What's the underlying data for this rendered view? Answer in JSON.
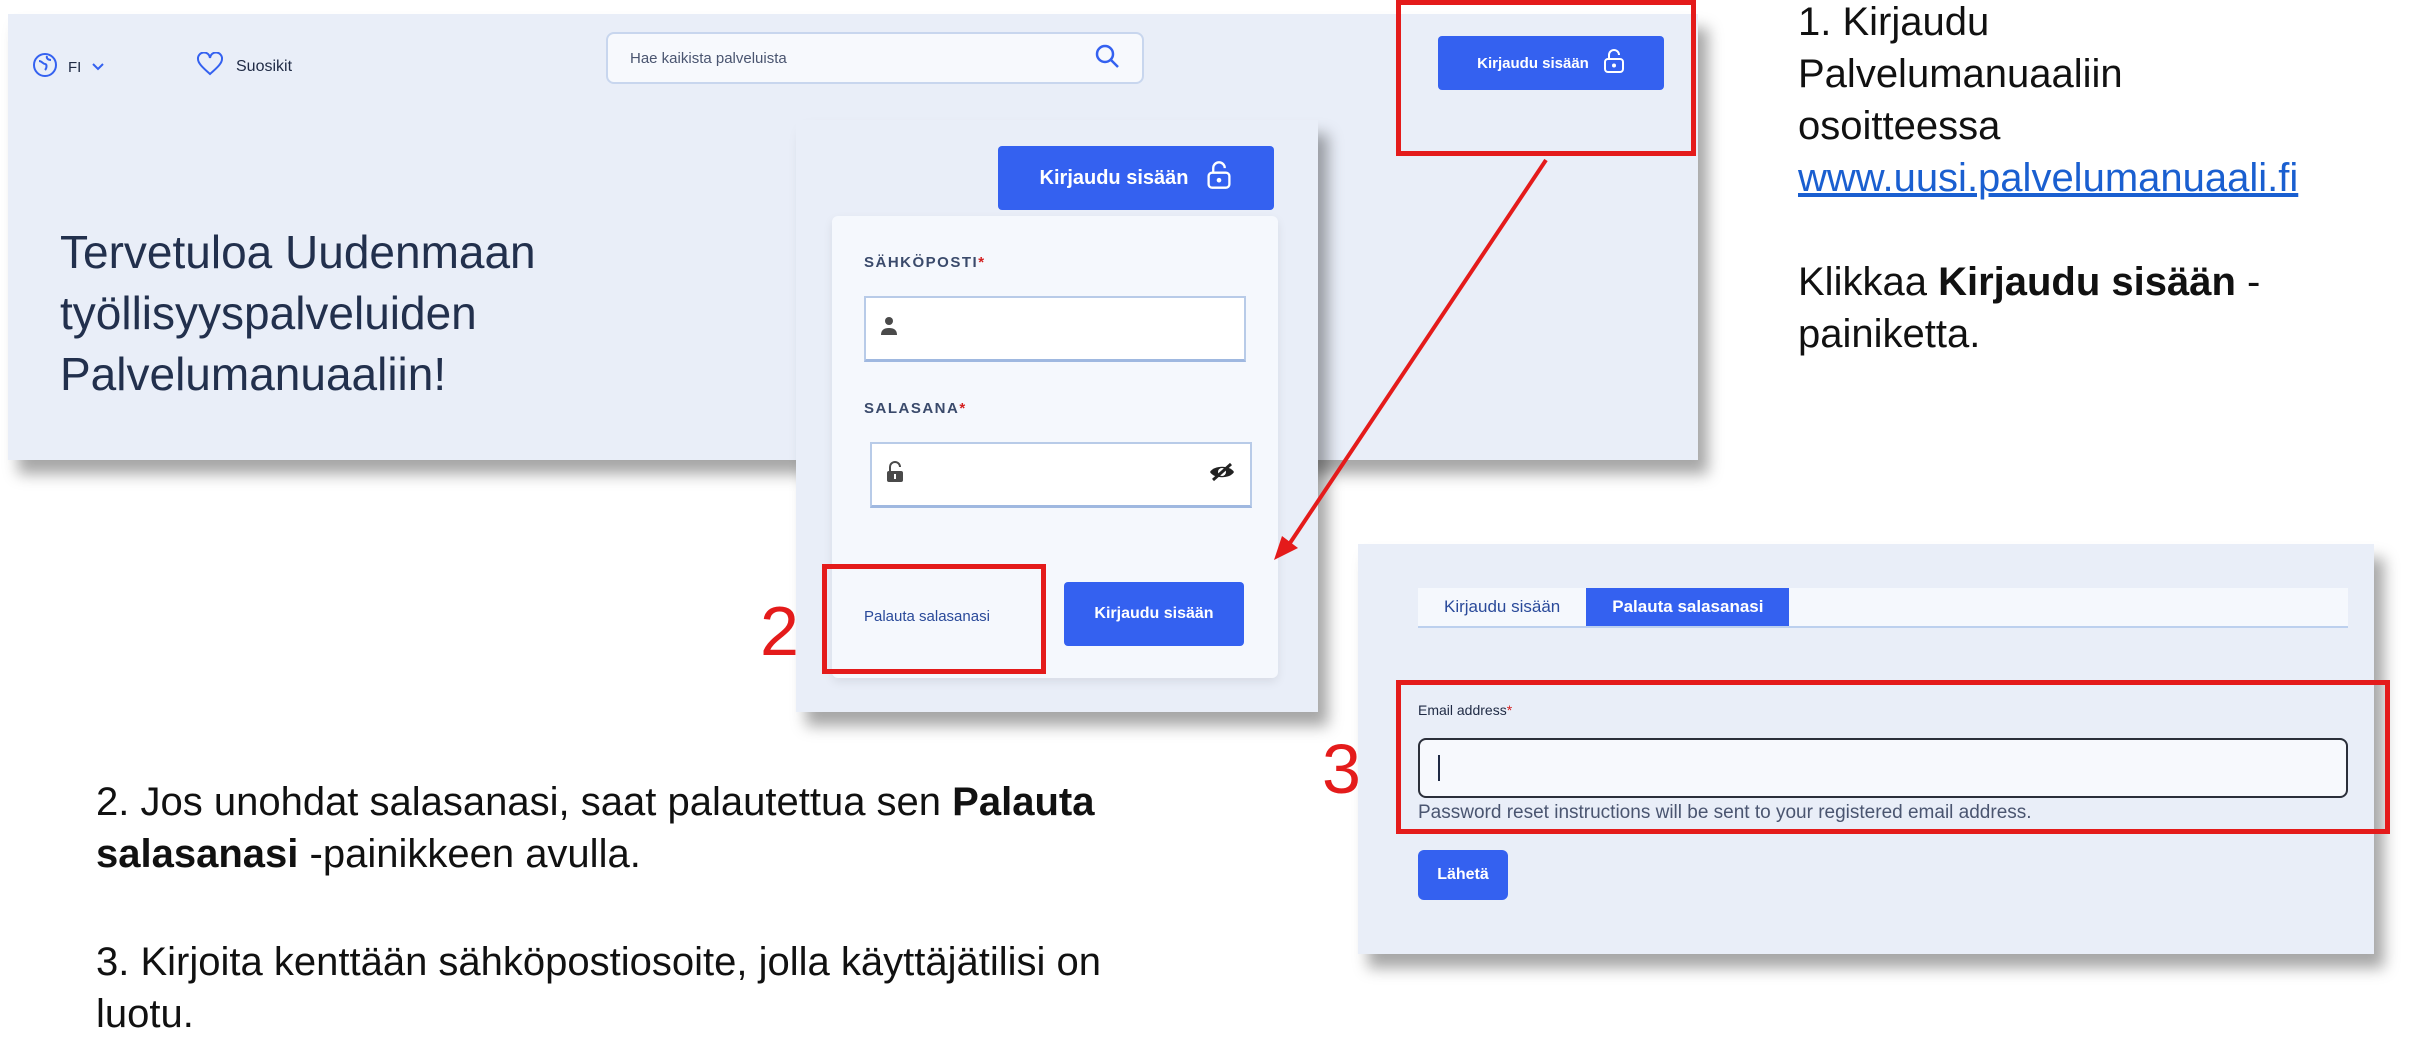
{
  "header": {
    "lang_label": "FI",
    "favorites_label": "Suosikit",
    "search_placeholder": "Hae kaikista palveluista",
    "login_label": "Kirjaudu sisään"
  },
  "hero": {
    "lines": [
      "Tervetuloa Uudenmaan",
      "työllisyyspalveluiden",
      "Palvelumanuaaliin!"
    ]
  },
  "login_form": {
    "top_button_label": "Kirjaudu sisään",
    "email_label": "SÄHKÖPOSTI",
    "password_label": "SALASANA",
    "required_mark": "*",
    "forgot_label": "Palauta salasanasi",
    "submit_label": "Kirjaudu sisään"
  },
  "reset_form": {
    "tabs": [
      {
        "label": "Kirjaudu sisään",
        "active": false
      },
      {
        "label": "Palauta salasanasi",
        "active": true
      }
    ],
    "email_label": "Email address",
    "required_mark": "*",
    "help_text": "Password reset instructions will be sent to your registered email address.",
    "send_label": "Lähetä"
  },
  "annotations": {
    "step2_number": "2",
    "step3_number": "3"
  },
  "instructions": {
    "step1": {
      "line1": "1. Kirjaudu",
      "line2": "Palvelumanuaaliin",
      "line3": "osoitteessa",
      "url": "www.uusi.palvelumanuaali.fi",
      "click_prefix": "Klikkaa ",
      "click_bold": "Kirjaudu sisään",
      "click_suffix": " -",
      "click_line2": "painiketta."
    },
    "step2": {
      "prefix": "2. Jos unohdat salasanasi, saat palautettua sen ",
      "bold1": "Palauta",
      "bold2": "salasanasi",
      "suffix": " -painikkeen avulla."
    },
    "step3": {
      "line1": "3. Kirjoita kenttään sähköpostiosoite, jolla käyttäjätilisi on",
      "line2": "luotu."
    }
  },
  "colors": {
    "accent": "#3461f0",
    "panel_bg": "#e9eef8",
    "annotation_red": "#e41b1b",
    "link": "#1a5fd0"
  },
  "icons": [
    "globe-icon",
    "chevron-down-icon",
    "heart-icon",
    "search-icon",
    "unlock-icon",
    "user-icon",
    "lock-icon",
    "eye-slash-icon"
  ]
}
